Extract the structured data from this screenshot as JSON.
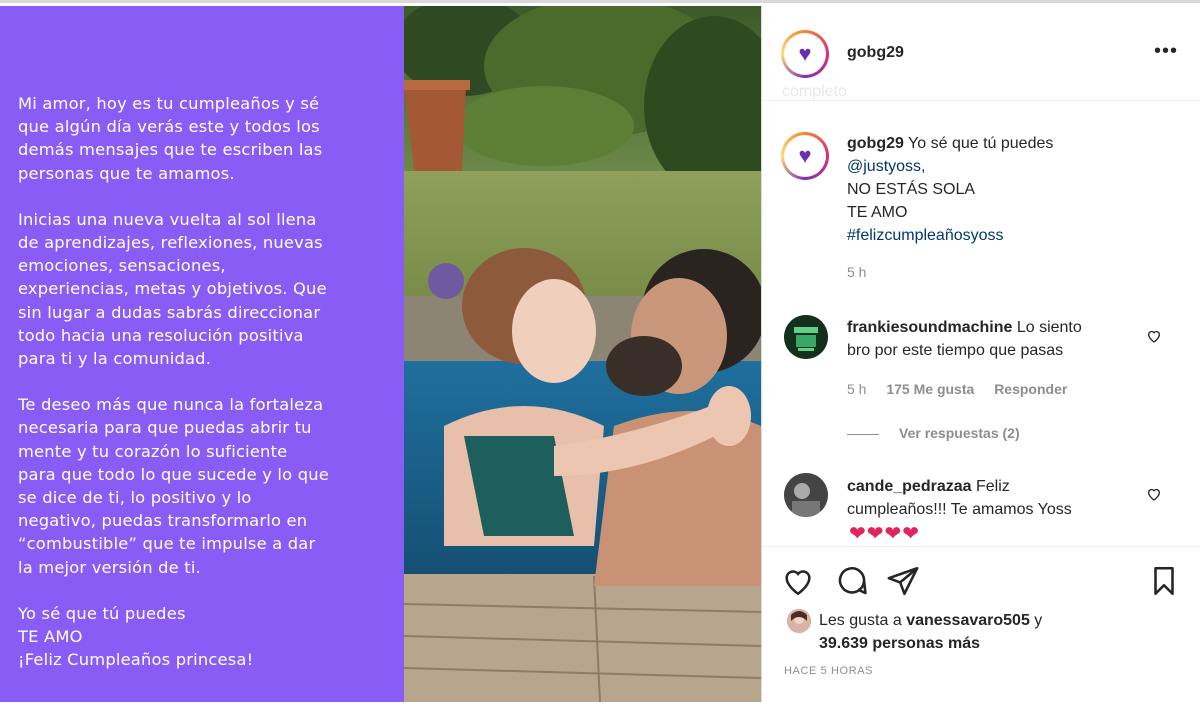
{
  "text_panel": {
    "paragraphs": [
      "Mi amor, hoy es tu cumpleaños y sé\nque algún día verás este y todos los\ndemás mensajes que te escriben las\npersonas que te amamos.",
      "Inicias una nueva vuelta al sol llena\nde aprendizajes, reflexiones, nuevas\nemociones, sensaciones,\nexperiencias, metas y objetivos. Que\nsin lugar a dudas sabrás direccionar\ntodo hacia una resolución positiva\npara ti y la comunidad.",
      "Te deseo más que nunca la fortaleza\nnecesaria para que puedas abrir tu\nmente y tu corazón lo suficiente\npara que todo lo que sucede y lo que\nse dice de ti, lo positivo y lo\nnegativo, puedas transformarlo en\n“combustible” que te impulse a dar\nla mejor versión de ti.",
      "Yo sé que tú puedes\nTE AMO\n¡Feliz Cumpleaños princesa!"
    ],
    "background": "#8a5cf6"
  },
  "post": {
    "username": "gobg29",
    "avatar_icon": "purple-heart-icon",
    "more_icon": "more-options-icon",
    "ghost_text": "completo",
    "caption": {
      "username": "gobg29",
      "line1": "Yo sé que tú puedes",
      "mention": "@justyoss,",
      "line3": "NO ESTÁS SOLA",
      "line4": "TE AMO",
      "hashtag": "#felizcumpleañosyoss",
      "time": "5 h"
    },
    "comments": [
      {
        "username": "frankiesoundmachine",
        "text_a": "Lo siento",
        "text_b": "bro por este tiempo que pasas",
        "time": "5 h",
        "likes": "175 Me gusta",
        "reply": "Responder",
        "view_replies": "Ver respuestas (2)"
      },
      {
        "username": "cande_pedrazaa",
        "text_a": "Feliz",
        "text_b": "cumpleaños!!! Te amamos Yoss",
        "emoji": "❤❤❤❤"
      }
    ],
    "likes": {
      "prefix": "Les gusta a",
      "user": "vanessavaro505",
      "joiner": "y",
      "count": "39.639 personas más"
    },
    "posted": "HACE 5 HORAS"
  }
}
